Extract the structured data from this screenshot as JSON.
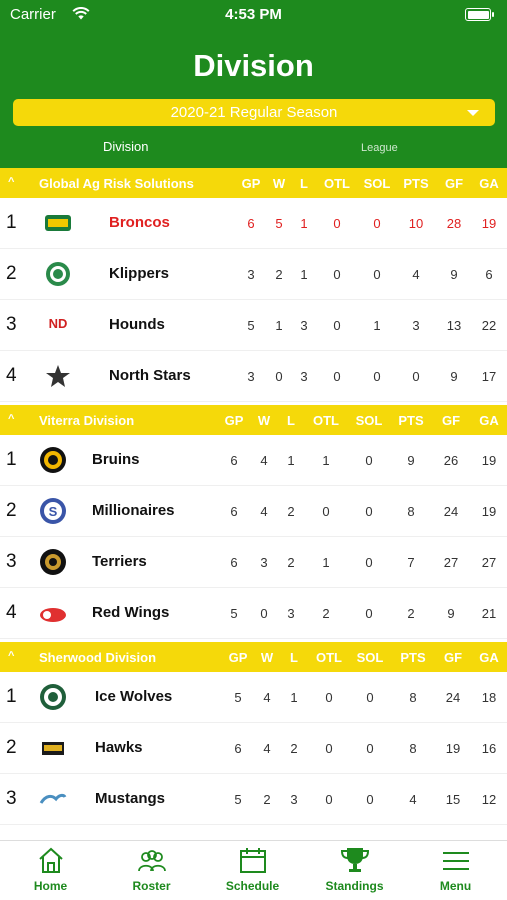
{
  "status": {
    "carrier": "Carrier",
    "time": "4:53 PM"
  },
  "header": {
    "title": "Division",
    "season": "2020-21 Regular Season",
    "tabs": [
      "Division",
      "League"
    ]
  },
  "columns": [
    "GP",
    "W",
    "L",
    "OTL",
    "SOL",
    "PTS",
    "GF",
    "GA"
  ],
  "divisions": [
    {
      "name": "Global Ag Risk Solutions",
      "teams": [
        {
          "rank": "1",
          "name": "Broncos",
          "logo": "broncos-logo",
          "stats": [
            "6",
            "5",
            "1",
            "0",
            "0",
            "10",
            "28",
            "19"
          ],
          "highlight": true
        },
        {
          "rank": "2",
          "name": "Klippers",
          "logo": "klippers-logo",
          "stats": [
            "3",
            "2",
            "1",
            "0",
            "0",
            "4",
            "9",
            "6"
          ]
        },
        {
          "rank": "3",
          "name": "Hounds",
          "logo": "hounds-logo",
          "stats": [
            "5",
            "1",
            "3",
            "0",
            "1",
            "3",
            "13",
            "22"
          ]
        },
        {
          "rank": "4",
          "name": "North Stars",
          "logo": "north-stars-logo",
          "stats": [
            "3",
            "0",
            "3",
            "0",
            "0",
            "0",
            "9",
            "17"
          ]
        }
      ]
    },
    {
      "name": "Viterra Division",
      "teams": [
        {
          "rank": "1",
          "name": "Bruins",
          "logo": "bruins-logo",
          "stats": [
            "6",
            "4",
            "1",
            "1",
            "0",
            "9",
            "26",
            "19"
          ]
        },
        {
          "rank": "2",
          "name": "Millionaires",
          "logo": "millionaires-logo",
          "stats": [
            "6",
            "4",
            "2",
            "0",
            "0",
            "8",
            "24",
            "19"
          ]
        },
        {
          "rank": "3",
          "name": "Terriers",
          "logo": "terriers-logo",
          "stats": [
            "6",
            "3",
            "2",
            "1",
            "0",
            "7",
            "27",
            "27"
          ]
        },
        {
          "rank": "4",
          "name": "Red Wings",
          "logo": "red-wings-logo",
          "stats": [
            "5",
            "0",
            "3",
            "2",
            "0",
            "2",
            "9",
            "21"
          ]
        }
      ]
    },
    {
      "name": "Sherwood Division",
      "teams": [
        {
          "rank": "1",
          "name": "Ice Wolves",
          "logo": "ice-wolves-logo",
          "stats": [
            "5",
            "4",
            "1",
            "0",
            "0",
            "8",
            "24",
            "18"
          ]
        },
        {
          "rank": "2",
          "name": "Hawks",
          "logo": "hawks-logo",
          "stats": [
            "6",
            "4",
            "2",
            "0",
            "0",
            "8",
            "19",
            "16"
          ]
        },
        {
          "rank": "3",
          "name": "Mustangs",
          "logo": "mustangs-logo",
          "stats": [
            "5",
            "2",
            "3",
            "0",
            "0",
            "4",
            "15",
            "12"
          ]
        }
      ]
    }
  ],
  "tabbar": [
    {
      "label": "Home",
      "icon": "home-icon"
    },
    {
      "label": "Roster",
      "icon": "roster-icon"
    },
    {
      "label": "Schedule",
      "icon": "calendar-icon"
    },
    {
      "label": "Standings",
      "icon": "trophy-icon"
    },
    {
      "label": "Menu",
      "icon": "menu-icon"
    }
  ],
  "colors": {
    "header_green": "#1e8a1e",
    "section_yellow": "#f5d90a",
    "highlight_red": "#e02020"
  }
}
